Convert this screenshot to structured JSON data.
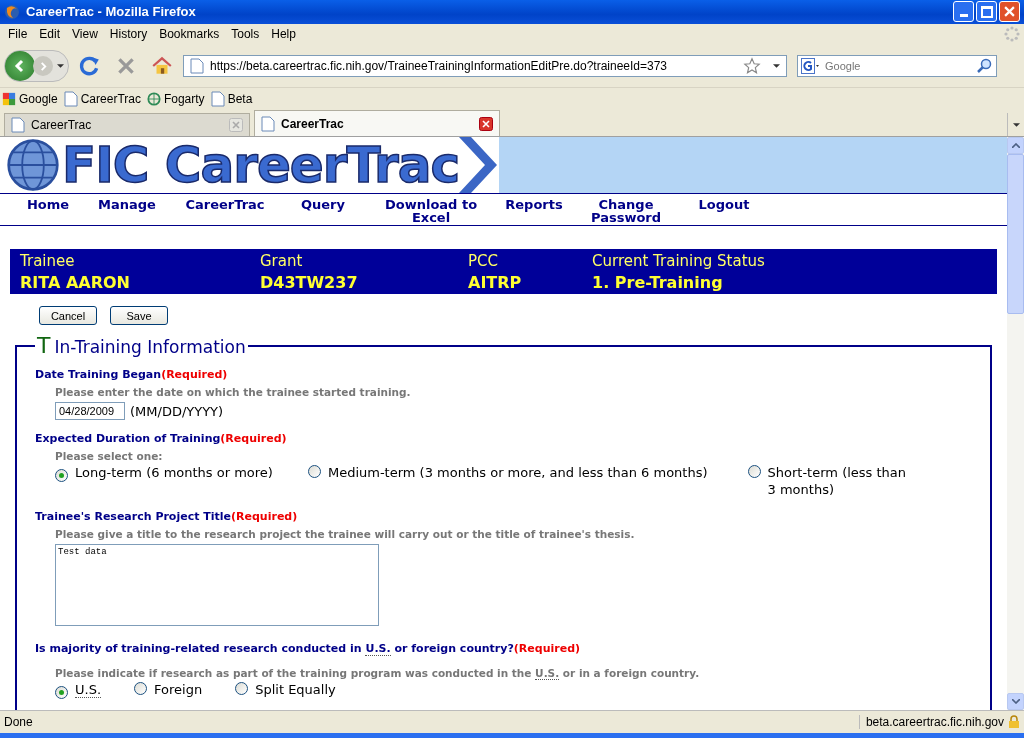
{
  "window": {
    "title": "CareerTrac - Mozilla Firefox"
  },
  "menu": [
    "File",
    "Edit",
    "View",
    "History",
    "Bookmarks",
    "Tools",
    "Help"
  ],
  "address": {
    "value": "https://beta.careertrac.fic.nih.gov/TraineeTrainingInformationEditPre.do?traineeId=373"
  },
  "search": {
    "placeholder": "Google"
  },
  "bookmarks": [
    {
      "label": "Google",
      "kind": "google"
    },
    {
      "label": "CareerTrac",
      "kind": "page"
    },
    {
      "label": "Fogarty",
      "kind": "fogarty"
    },
    {
      "label": "Beta",
      "kind": "page"
    }
  ],
  "tabs": [
    {
      "label": "CareerTrac",
      "selected": false
    },
    {
      "label": "CareerTrac",
      "selected": true
    }
  ],
  "logo": {
    "text": "FIC CareerTrac"
  },
  "nav": [
    "Home",
    "Manage",
    "CareerTrac",
    "Query",
    "Download to Excel",
    "Reports",
    "Change Password",
    "Logout"
  ],
  "summary": [
    {
      "label": "Trainee",
      "value": "RITA AARON"
    },
    {
      "label": "Grant",
      "value": "D43TW237"
    },
    {
      "label": "PCC",
      "value": "AITRP"
    },
    {
      "label": "Current Training Status",
      "value": "1. Pre-Training"
    }
  ],
  "buttons": [
    "Cancel",
    "Save"
  ],
  "section": {
    "initial": "T",
    "title": "In-Training Information"
  },
  "fields": [
    {
      "kind": "date",
      "label": "Date Training Began",
      "required": "(Required)",
      "hint": "Please enter the date on which the trainee started training.",
      "value": "04/28/2009",
      "format": "(MM/DD/YYYY)"
    },
    {
      "kind": "radio",
      "label": "Expected Duration of Training",
      "required": "(Required)",
      "hint": "Please select one:",
      "options": [
        {
          "label": "Long-term (6 months or more)",
          "selected": true
        },
        {
          "label": "Medium-term (3 months or more, and less than 6 months)",
          "selected": false
        },
        {
          "label": "Short-term (less than 3 months)",
          "selected": false
        }
      ]
    },
    {
      "kind": "textarea",
      "label": "Trainee's Research Project Title",
      "required": "(Required)",
      "hint": "Please give a title to the research project the trainee will carry out or the title of trainee's thesis.",
      "value": "Test data"
    },
    {
      "kind": "radio-abbr",
      "label": "Is majority of training-related research conducted in ",
      "label_abbr": "U.S.",
      "label_after": " or foreign country?",
      "required": "(Required)",
      "hint": "Please indicate if research as part of the training program was conducted in the ",
      "hint_abbr": "U.S.",
      "hint_after": " or in a foreign country.",
      "options": [
        {
          "label": "U.S.",
          "selected": true,
          "abbr": true
        },
        {
          "label": "Foreign",
          "selected": false,
          "abbr": false
        },
        {
          "label": "Split Equally",
          "selected": false,
          "abbr": false
        }
      ]
    }
  ],
  "status_bar": {
    "text": "Done",
    "host": "beta.careertrac.fic.nih.gov"
  }
}
